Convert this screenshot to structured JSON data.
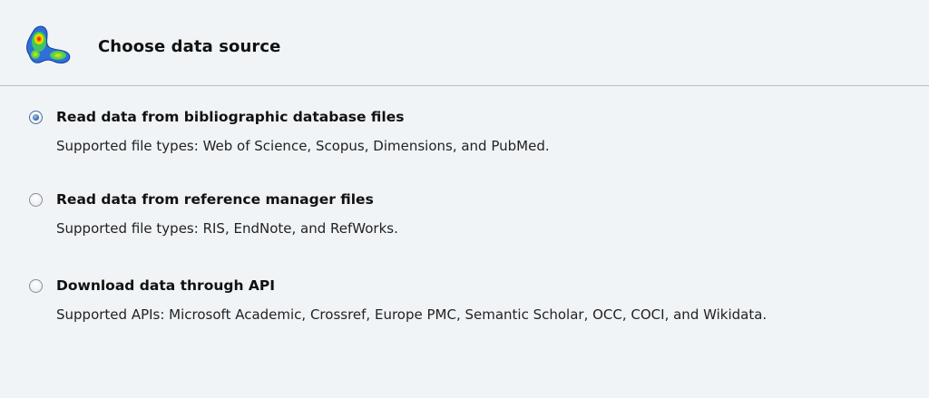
{
  "header": {
    "title": "Choose data source",
    "logo_icon": "vosviewer-density-logo-icon"
  },
  "options": [
    {
      "label": "Read data from bibliographic database files",
      "description": "Supported file types: Web of Science, Scopus, Dimensions, and PubMed.",
      "selected": true
    },
    {
      "label": "Read data from reference manager files",
      "description": "Supported file types: RIS, EndNote, and RefWorks.",
      "selected": false
    },
    {
      "label": "Download data through API",
      "description": "Supported APIs: Microsoft Academic, Crossref, Europe PMC, Semantic Scholar, OCC, COCI, and Wikidata.",
      "selected": false
    }
  ],
  "colors": {
    "background": "#f1f4f7",
    "divider": "#b7bcc2",
    "radio_selected": "#3f6fb0"
  }
}
